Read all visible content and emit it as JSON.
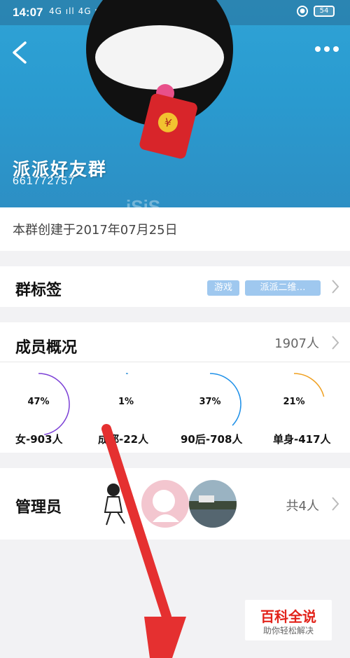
{
  "status_bar": {
    "time": "14:07",
    "signal": "4G ıll 4G ıll",
    "battery": "54"
  },
  "header": {
    "group_name": "派派好友群",
    "group_id": "661772757",
    "background_color": "#2a9bd0"
  },
  "created_text": "本群创建于2017年07月25日",
  "tags_row": {
    "title": "群标签",
    "tags": [
      "游戏",
      "派派二维…"
    ]
  },
  "members": {
    "title": "成员概况",
    "count": "1907人",
    "stats": [
      {
        "percent_label": "47%",
        "percent": 47,
        "label": "女-903人",
        "color": "#7b3fd6"
      },
      {
        "percent_label": "1%",
        "percent": 1,
        "label": "成都-22人",
        "color": "#2d8fd6"
      },
      {
        "percent_label": "37%",
        "percent": 37,
        "label": "90后-708人",
        "color": "#1e90e8"
      },
      {
        "percent_label": "21%",
        "percent": 21,
        "label": "单身-417人",
        "color": "#f0a020"
      }
    ]
  },
  "admins": {
    "title": "管理员",
    "count": "共4人"
  },
  "watermark": {
    "title": "百科全说",
    "subtitle": "助你轻松解决"
  }
}
